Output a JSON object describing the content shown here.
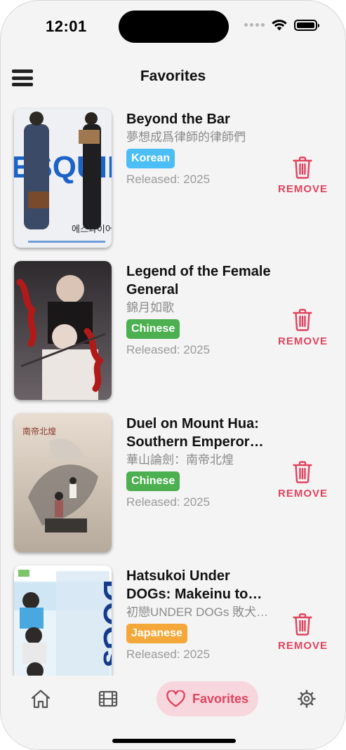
{
  "status_bar": {
    "time": "12:01"
  },
  "header": {
    "title": "Favorites"
  },
  "colors": {
    "accent": "#e0445e",
    "badge_korean": "#4bbef5",
    "badge_chinese": "#4caf50",
    "badge_japanese": "#f5a83a"
  },
  "favorites": [
    {
      "title": "Beyond the Bar",
      "original_title": "夢想成爲律師的律師們",
      "language": "Korean",
      "released": "Released: 2025",
      "remove_label": "REMOVE",
      "poster_text": "에스콰이어"
    },
    {
      "title": "Legend of the Female General",
      "original_title": "錦月如歌",
      "language": "Chinese",
      "released": "Released: 2025",
      "remove_label": "REMOVE"
    },
    {
      "title": "Duel on Mount Hua: Southern Emperor…",
      "original_title": "華山論劍：南帝北煌",
      "language": "Chinese",
      "released": "Released: 2025",
      "remove_label": "REMOVE"
    },
    {
      "title": "Hatsukoi Under DOGs: Makeinu to…",
      "original_title": "初戀UNDER DOGs 敗犬…",
      "language": "Japanese",
      "released": "Released: 2025",
      "remove_label": "REMOVE",
      "poster_text": "DOGs"
    }
  ],
  "tabs": [
    {
      "icon": "home-icon"
    },
    {
      "icon": "film-icon"
    },
    {
      "icon": "heart-icon",
      "label": "Favorites",
      "active": true
    },
    {
      "icon": "gear-icon"
    }
  ]
}
